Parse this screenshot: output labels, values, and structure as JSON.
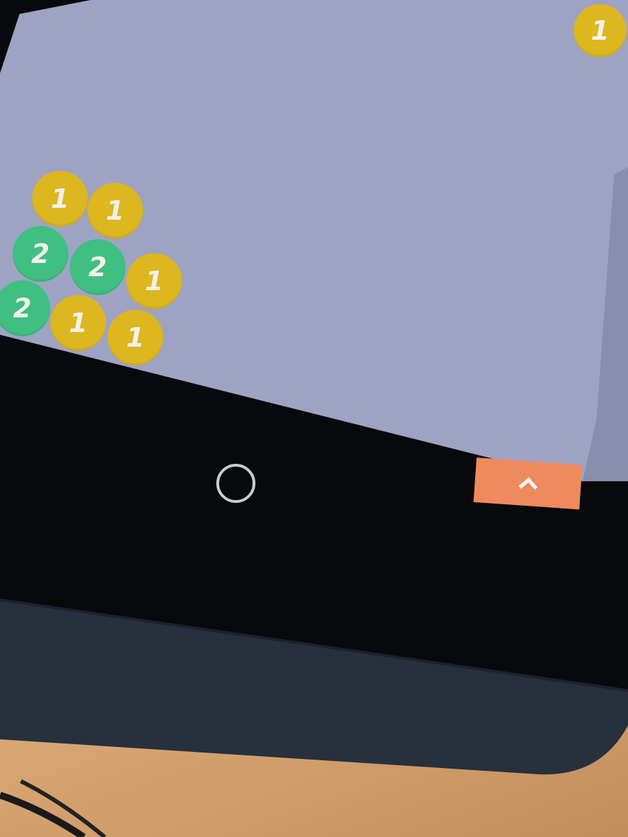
{
  "game": {
    "balls": [
      {
        "value": "1",
        "color": "yellow"
      },
      {
        "value": "1",
        "color": "yellow"
      },
      {
        "value": "1",
        "color": "yellow"
      },
      {
        "value": "2",
        "color": "green"
      },
      {
        "value": "2",
        "color": "green"
      },
      {
        "value": "1",
        "color": "yellow"
      },
      {
        "value": "2",
        "color": "green"
      },
      {
        "value": "1",
        "color": "yellow"
      },
      {
        "value": "1",
        "color": "yellow"
      }
    ]
  },
  "colors": {
    "screen": "#9ea3c4",
    "yellow_ball": "#dcb71f",
    "green_ball": "#3fbf80",
    "up_button": "#ef8a5c",
    "bezel": "#050608",
    "case": "#27303d",
    "desk": "#c9975f"
  },
  "icons": {
    "home": "circle-outline",
    "up": "chevron-up"
  }
}
